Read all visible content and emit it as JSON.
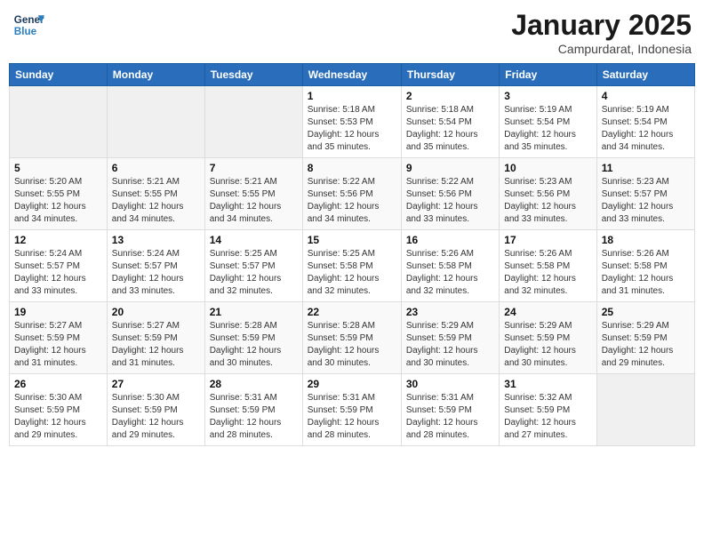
{
  "header": {
    "logo_line1": "General",
    "logo_line2": "Blue",
    "month": "January 2025",
    "location": "Campurdarat, Indonesia"
  },
  "weekdays": [
    "Sunday",
    "Monday",
    "Tuesday",
    "Wednesday",
    "Thursday",
    "Friday",
    "Saturday"
  ],
  "weeks": [
    [
      {
        "day": "",
        "info": ""
      },
      {
        "day": "",
        "info": ""
      },
      {
        "day": "",
        "info": ""
      },
      {
        "day": "1",
        "info": "Sunrise: 5:18 AM\nSunset: 5:53 PM\nDaylight: 12 hours\nand 35 minutes."
      },
      {
        "day": "2",
        "info": "Sunrise: 5:18 AM\nSunset: 5:54 PM\nDaylight: 12 hours\nand 35 minutes."
      },
      {
        "day": "3",
        "info": "Sunrise: 5:19 AM\nSunset: 5:54 PM\nDaylight: 12 hours\nand 35 minutes."
      },
      {
        "day": "4",
        "info": "Sunrise: 5:19 AM\nSunset: 5:54 PM\nDaylight: 12 hours\nand 34 minutes."
      }
    ],
    [
      {
        "day": "5",
        "info": "Sunrise: 5:20 AM\nSunset: 5:55 PM\nDaylight: 12 hours\nand 34 minutes."
      },
      {
        "day": "6",
        "info": "Sunrise: 5:21 AM\nSunset: 5:55 PM\nDaylight: 12 hours\nand 34 minutes."
      },
      {
        "day": "7",
        "info": "Sunrise: 5:21 AM\nSunset: 5:55 PM\nDaylight: 12 hours\nand 34 minutes."
      },
      {
        "day": "8",
        "info": "Sunrise: 5:22 AM\nSunset: 5:56 PM\nDaylight: 12 hours\nand 34 minutes."
      },
      {
        "day": "9",
        "info": "Sunrise: 5:22 AM\nSunset: 5:56 PM\nDaylight: 12 hours\nand 33 minutes."
      },
      {
        "day": "10",
        "info": "Sunrise: 5:23 AM\nSunset: 5:56 PM\nDaylight: 12 hours\nand 33 minutes."
      },
      {
        "day": "11",
        "info": "Sunrise: 5:23 AM\nSunset: 5:57 PM\nDaylight: 12 hours\nand 33 minutes."
      }
    ],
    [
      {
        "day": "12",
        "info": "Sunrise: 5:24 AM\nSunset: 5:57 PM\nDaylight: 12 hours\nand 33 minutes."
      },
      {
        "day": "13",
        "info": "Sunrise: 5:24 AM\nSunset: 5:57 PM\nDaylight: 12 hours\nand 33 minutes."
      },
      {
        "day": "14",
        "info": "Sunrise: 5:25 AM\nSunset: 5:57 PM\nDaylight: 12 hours\nand 32 minutes."
      },
      {
        "day": "15",
        "info": "Sunrise: 5:25 AM\nSunset: 5:58 PM\nDaylight: 12 hours\nand 32 minutes."
      },
      {
        "day": "16",
        "info": "Sunrise: 5:26 AM\nSunset: 5:58 PM\nDaylight: 12 hours\nand 32 minutes."
      },
      {
        "day": "17",
        "info": "Sunrise: 5:26 AM\nSunset: 5:58 PM\nDaylight: 12 hours\nand 32 minutes."
      },
      {
        "day": "18",
        "info": "Sunrise: 5:26 AM\nSunset: 5:58 PM\nDaylight: 12 hours\nand 31 minutes."
      }
    ],
    [
      {
        "day": "19",
        "info": "Sunrise: 5:27 AM\nSunset: 5:59 PM\nDaylight: 12 hours\nand 31 minutes."
      },
      {
        "day": "20",
        "info": "Sunrise: 5:27 AM\nSunset: 5:59 PM\nDaylight: 12 hours\nand 31 minutes."
      },
      {
        "day": "21",
        "info": "Sunrise: 5:28 AM\nSunset: 5:59 PM\nDaylight: 12 hours\nand 30 minutes."
      },
      {
        "day": "22",
        "info": "Sunrise: 5:28 AM\nSunset: 5:59 PM\nDaylight: 12 hours\nand 30 minutes."
      },
      {
        "day": "23",
        "info": "Sunrise: 5:29 AM\nSunset: 5:59 PM\nDaylight: 12 hours\nand 30 minutes."
      },
      {
        "day": "24",
        "info": "Sunrise: 5:29 AM\nSunset: 5:59 PM\nDaylight: 12 hours\nand 30 minutes."
      },
      {
        "day": "25",
        "info": "Sunrise: 5:29 AM\nSunset: 5:59 PM\nDaylight: 12 hours\nand 29 minutes."
      }
    ],
    [
      {
        "day": "26",
        "info": "Sunrise: 5:30 AM\nSunset: 5:59 PM\nDaylight: 12 hours\nand 29 minutes."
      },
      {
        "day": "27",
        "info": "Sunrise: 5:30 AM\nSunset: 5:59 PM\nDaylight: 12 hours\nand 29 minutes."
      },
      {
        "day": "28",
        "info": "Sunrise: 5:31 AM\nSunset: 5:59 PM\nDaylight: 12 hours\nand 28 minutes."
      },
      {
        "day": "29",
        "info": "Sunrise: 5:31 AM\nSunset: 5:59 PM\nDaylight: 12 hours\nand 28 minutes."
      },
      {
        "day": "30",
        "info": "Sunrise: 5:31 AM\nSunset: 5:59 PM\nDaylight: 12 hours\nand 28 minutes."
      },
      {
        "day": "31",
        "info": "Sunrise: 5:32 AM\nSunset: 5:59 PM\nDaylight: 12 hours\nand 27 minutes."
      },
      {
        "day": "",
        "info": ""
      }
    ]
  ]
}
